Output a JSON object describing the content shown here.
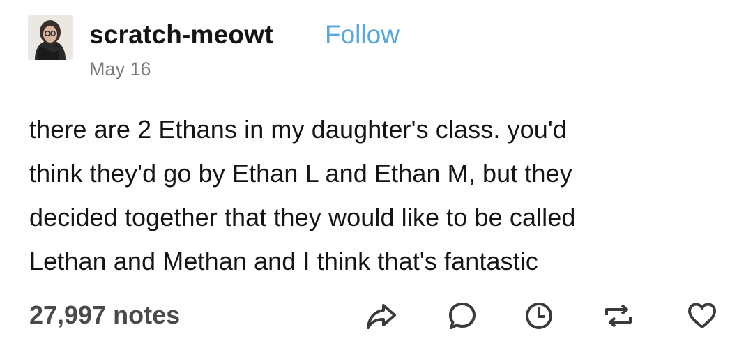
{
  "post": {
    "author": {
      "username": "scratch-meowt",
      "avatar_icon": "user-avatar-icon"
    },
    "follow_label": "Follow",
    "date": "May 16",
    "body_lines": [
      "there are 2 Ethans in my daughter's class. you'd",
      "think they'd go by Ethan L and Ethan M, but they",
      "decided together that they would like to be called",
      "Lethan and Methan and I think that's fantastic"
    ],
    "notes": "27,997 notes",
    "actions": [
      {
        "name": "share",
        "icon": "share-arrow-icon"
      },
      {
        "name": "reply",
        "icon": "speech-bubble-icon"
      },
      {
        "name": "queue",
        "icon": "clock-icon"
      },
      {
        "name": "reblog",
        "icon": "reblog-icon"
      },
      {
        "name": "like",
        "icon": "heart-icon"
      }
    ]
  },
  "colors": {
    "text": "#141414",
    "follow": "#56a8de",
    "date": "#7a7a7a",
    "notes": "#4a4a4a",
    "icons": "#3a3a3a"
  }
}
